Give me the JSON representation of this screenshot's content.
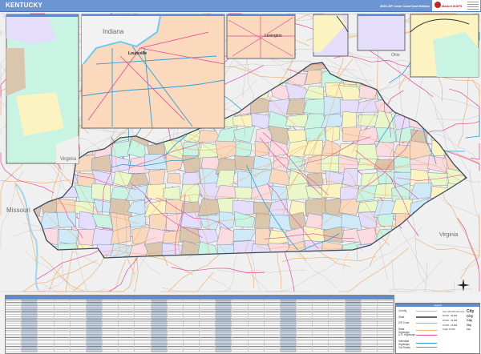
{
  "header": {
    "title": "KENTUCKY",
    "edition": "2026 ZIP Code ColorCast Edition",
    "logo_text": "Market MAPS"
  },
  "map": {
    "labels": {
      "indiana": "Indiana",
      "louisville": "Louisville",
      "lexington": "Lexington",
      "ohio": "Ohio",
      "missouri": "Missouri",
      "virginia": "Virginia",
      "virginia_inset": "Virginia"
    },
    "colors": {
      "state_border": "#3c4a5a",
      "us_highway": "#e8489a",
      "interstate": "#2d9fd8",
      "state_highway": "#f0a860",
      "zip": "#8090a8",
      "water": "#9fd8f0"
    },
    "county_palette": [
      "#f9d8bd",
      "#c9f3e3",
      "#e4defa",
      "#fbf3c0",
      "#d9c6ad",
      "#fadbe0",
      "#cfe9f7",
      "#e9f7c9"
    ]
  },
  "legend": {
    "header": "Legend",
    "items": [
      {
        "label": "County",
        "color": "#bbbbbb"
      },
      {
        "label": "State",
        "color": "#666666"
      },
      {
        "label": "ZIP Code",
        "color": "#8fb5e0"
      },
      {
        "label": "State Highways",
        "color": "#f0b070"
      },
      {
        "label": "U.S. Highways",
        "color": "#e8489a"
      },
      {
        "label": "Interstate Highways",
        "color": "#2d9fd8"
      },
      {
        "label": "Toll Roads",
        "color": "#3cc040"
      }
    ],
    "city_sizes": [
      {
        "label": "Over 100,000 and more",
        "sample": "City"
      },
      {
        "label": "50,000 - 99,999",
        "sample": "City"
      },
      {
        "label": "25,000 - 49,999",
        "sample": "City"
      },
      {
        "label": "10,000 - 24,999",
        "sample": "City"
      },
      {
        "label": "Under 10,000",
        "sample": "City"
      }
    ]
  }
}
